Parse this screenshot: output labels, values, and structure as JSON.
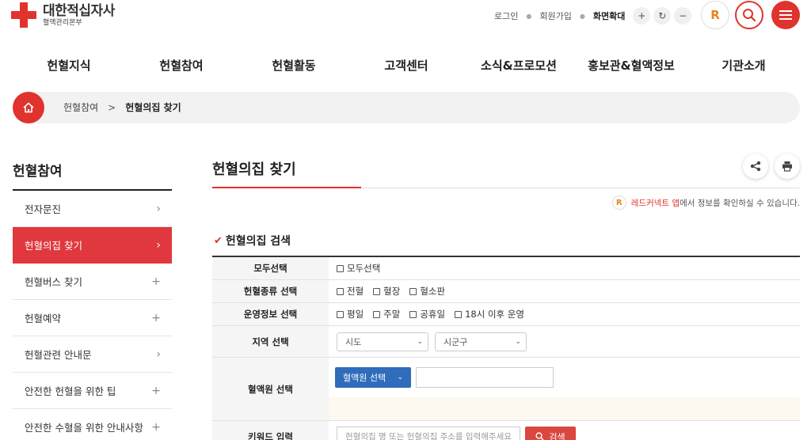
{
  "header": {
    "logo_title": "대한적십자사",
    "logo_subtitle": "혈액관리본부",
    "util": {
      "login": "로그인",
      "join": "회원가입",
      "zoom_label": "화면확대",
      "zoom_in": "+",
      "zoom_reset": "↻",
      "zoom_out": "−"
    },
    "app_badge": "R"
  },
  "gnb": [
    "헌혈지식",
    "헌혈참여",
    "헌혈활동",
    "고객센터",
    "소식&프로모션",
    "홍보관&혈액정보",
    "기관소개"
  ],
  "breadcrumb": {
    "parent": "헌혈참여",
    "arrow": ">",
    "current": "헌혈의집 찾기"
  },
  "sidebar": {
    "title": "헌혈참여",
    "items": [
      {
        "label": "전자문진",
        "mark": "›"
      },
      {
        "label": "헌혈의집 찾기",
        "mark": "›"
      },
      {
        "label": "헌혈버스 찾기",
        "mark": "+"
      },
      {
        "label": "헌혈예약",
        "mark": "+"
      },
      {
        "label": "헌혈관련 안내문",
        "mark": "›"
      },
      {
        "label": "안전한 헌혈을 위한 팁",
        "mark": "+"
      },
      {
        "label": "안전한 수혈을 위한 안내사항",
        "mark": "+"
      }
    ]
  },
  "main": {
    "title": "헌혈의집 찾기",
    "app_note": {
      "badge": "R",
      "app_name": "레드커넥트 앱",
      "text": "에서 정보를 확인하실 수 있습니다."
    },
    "section_title": "헌혈의집 검색",
    "section_mark": "✔",
    "form": {
      "all": {
        "label": "모두선택",
        "options": [
          "모두선택"
        ]
      },
      "type": {
        "label": "헌혈종류 선택",
        "options": [
          "전혈",
          "혈장",
          "혈소판"
        ]
      },
      "ops": {
        "label": "운영정보 선택",
        "options": [
          "평일",
          "주말",
          "공휴일",
          "18시 이후 운영"
        ]
      },
      "region": {
        "label": "지역 선택",
        "sido": "시도",
        "sigungu": "시군구"
      },
      "center": {
        "label": "혈액원 선택",
        "select": "혈액원 선택"
      },
      "keyword": {
        "label": "키워드 입력",
        "placeholder": "헌혈의집 명 또는 헌혈의집 주소를 입력해주세요",
        "button": "검색"
      }
    }
  },
  "colors": {
    "brand_red": "#e0332d",
    "active_side": "#e0383e",
    "select_blue": "#2f6dbb"
  }
}
